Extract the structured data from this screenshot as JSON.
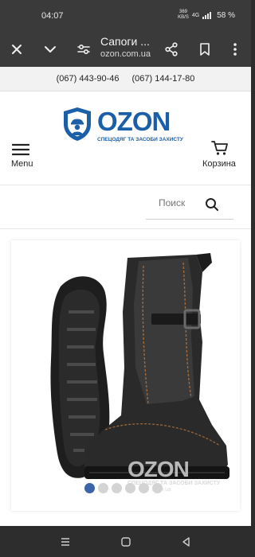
{
  "status": {
    "time": "04:07",
    "net_speed_value": "369",
    "net_speed_unit": "KB/S",
    "network": "4G",
    "battery": "58 %"
  },
  "browser": {
    "title": "Сапоги ...",
    "url": "ozon.com.ua"
  },
  "site": {
    "phones": [
      "(067) 443-90-46",
      "(067) 144-17-80"
    ],
    "logo_text": "OZON",
    "logo_tagline": "СПЕЦОДЯГ ТА ЗАСОБИ ЗАХИСТУ",
    "menu_label": "Menu",
    "cart_label": "Корзина",
    "search_placeholder": "Поиск"
  },
  "product": {
    "watermark_text": "OZON",
    "watermark_tagline": "СПЕЦОДЯГ ТА ЗАСОБИ ЗАХИСТУ",
    "watermark_url": ".com.ua",
    "gallery_count": 6,
    "gallery_active": 1
  },
  "colors": {
    "brand": "#1b5fa8",
    "active_dot": "#3c64a8",
    "browser_chrome": "#3a3a3a"
  },
  "icons": [
    "close-icon",
    "chevron-down-icon",
    "page-settings-icon",
    "share-icon",
    "bookmark-icon",
    "more-icon",
    "hamburger-icon",
    "cart-icon",
    "search-icon",
    "recents-icon",
    "home-icon",
    "back-icon"
  ]
}
